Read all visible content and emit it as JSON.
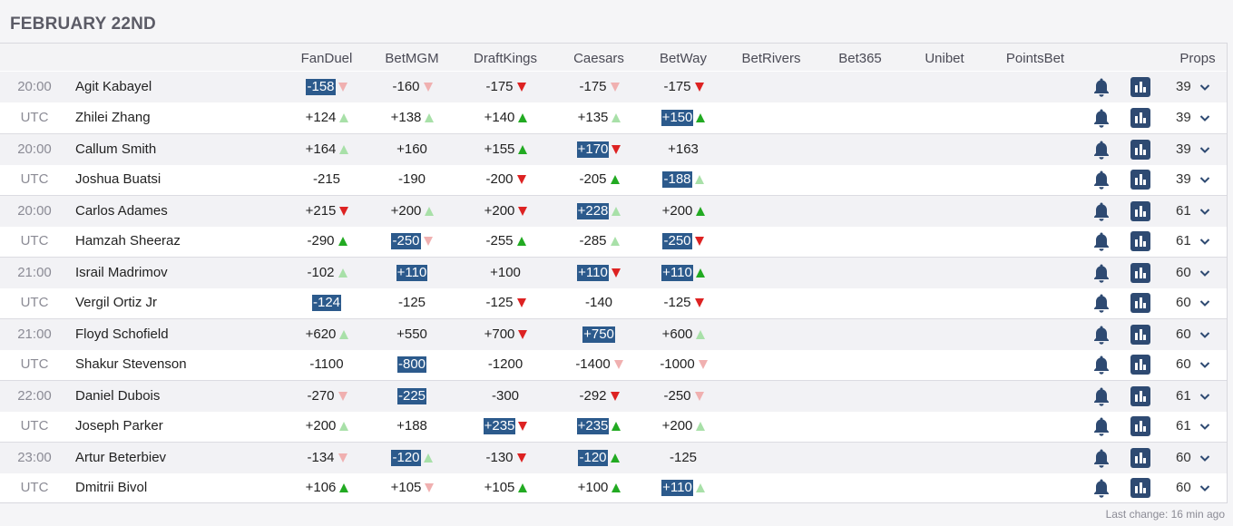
{
  "date_heading": "FEBRUARY 22ND",
  "columns": [
    "FanDuel",
    "BetMGM",
    "DraftKings",
    "Caesars",
    "BetWay",
    "BetRivers",
    "Bet365",
    "Unibet",
    "PointsBet"
  ],
  "props_label": "Props",
  "footer_note": "Last change: 16 min ago",
  "colors": {
    "best_bg": "#2c5a8c",
    "up_strong": "#22aa22",
    "up_light": "#a8e0a8",
    "down_strong": "#dd2222",
    "down_light": "#f0b0b0",
    "icon_navy": "#2e4a72"
  },
  "rows": [
    {
      "time": "20:00",
      "fighter": "Agit Kabayel",
      "props": "39",
      "odds": [
        {
          "v": "-158",
          "best": true,
          "a": "down-light"
        },
        {
          "v": "-160",
          "a": "down-light"
        },
        {
          "v": "-175",
          "a": "down-strong"
        },
        {
          "v": "-175",
          "a": "down-light"
        },
        {
          "v": "-175",
          "a": "down-strong"
        }
      ]
    },
    {
      "time": "UTC",
      "fighter": "Zhilei Zhang",
      "props": "39",
      "odds": [
        {
          "v": "+124",
          "a": "up-light"
        },
        {
          "v": "+138",
          "a": "up-light"
        },
        {
          "v": "+140",
          "a": "up-strong"
        },
        {
          "v": "+135",
          "a": "up-light"
        },
        {
          "v": "+150",
          "best": true,
          "a": "up-strong"
        }
      ]
    },
    {
      "time": "20:00",
      "fighter": "Callum Smith",
      "props": "39",
      "odds": [
        {
          "v": "+164",
          "a": "up-light"
        },
        {
          "v": "+160"
        },
        {
          "v": "+155",
          "a": "up-strong"
        },
        {
          "v": "+170",
          "best": true,
          "a": "down-strong"
        },
        {
          "v": "+163"
        }
      ]
    },
    {
      "time": "UTC",
      "fighter": "Joshua Buatsi",
      "props": "39",
      "odds": [
        {
          "v": "-215"
        },
        {
          "v": "-190"
        },
        {
          "v": "-200",
          "a": "down-strong"
        },
        {
          "v": "-205",
          "a": "up-strong"
        },
        {
          "v": "-188",
          "best": true,
          "a": "up-light"
        }
      ]
    },
    {
      "time": "20:00",
      "fighter": "Carlos Adames",
      "props": "61",
      "odds": [
        {
          "v": "+215",
          "a": "down-strong"
        },
        {
          "v": "+200",
          "a": "up-light"
        },
        {
          "v": "+200",
          "a": "down-strong"
        },
        {
          "v": "+228",
          "best": true,
          "a": "up-light"
        },
        {
          "v": "+200",
          "a": "up-strong"
        }
      ]
    },
    {
      "time": "UTC",
      "fighter": "Hamzah Sheeraz",
      "props": "61",
      "odds": [
        {
          "v": "-290",
          "a": "up-strong"
        },
        {
          "v": "-250",
          "best": true,
          "a": "down-light"
        },
        {
          "v": "-255",
          "a": "up-strong"
        },
        {
          "v": "-285",
          "a": "up-light"
        },
        {
          "v": "-250",
          "best": true,
          "a": "down-strong"
        }
      ]
    },
    {
      "time": "21:00",
      "fighter": "Israil Madrimov",
      "props": "60",
      "odds": [
        {
          "v": "-102",
          "a": "up-light"
        },
        {
          "v": "+110",
          "best": true
        },
        {
          "v": "+100"
        },
        {
          "v": "+110",
          "best": true,
          "a": "down-strong"
        },
        {
          "v": "+110",
          "best": true,
          "a": "up-strong"
        }
      ]
    },
    {
      "time": "UTC",
      "fighter": "Vergil Ortiz Jr",
      "props": "60",
      "odds": [
        {
          "v": "-124",
          "best": true
        },
        {
          "v": "-125"
        },
        {
          "v": "-125",
          "a": "down-strong"
        },
        {
          "v": "-140"
        },
        {
          "v": "-125",
          "a": "down-strong"
        }
      ]
    },
    {
      "time": "21:00",
      "fighter": "Floyd Schofield",
      "props": "60",
      "odds": [
        {
          "v": "+620",
          "a": "up-light"
        },
        {
          "v": "+550"
        },
        {
          "v": "+700",
          "a": "down-strong"
        },
        {
          "v": "+750",
          "best": true
        },
        {
          "v": "+600",
          "a": "up-light"
        }
      ]
    },
    {
      "time": "UTC",
      "fighter": "Shakur Stevenson",
      "props": "60",
      "odds": [
        {
          "v": "-1100"
        },
        {
          "v": "-800",
          "best": true
        },
        {
          "v": "-1200"
        },
        {
          "v": "-1400",
          "a": "down-light"
        },
        {
          "v": "-1000",
          "a": "down-light"
        }
      ]
    },
    {
      "time": "22:00",
      "fighter": "Daniel Dubois",
      "props": "61",
      "odds": [
        {
          "v": "-270",
          "a": "down-light"
        },
        {
          "v": "-225",
          "best": true
        },
        {
          "v": "-300"
        },
        {
          "v": "-292",
          "a": "down-strong"
        },
        {
          "v": "-250",
          "a": "down-light"
        }
      ]
    },
    {
      "time": "UTC",
      "fighter": "Joseph Parker",
      "props": "61",
      "odds": [
        {
          "v": "+200",
          "a": "up-light"
        },
        {
          "v": "+188"
        },
        {
          "v": "+235",
          "best": true,
          "a": "down-strong"
        },
        {
          "v": "+235",
          "best": true,
          "a": "up-strong"
        },
        {
          "v": "+200",
          "a": "up-light"
        }
      ]
    },
    {
      "time": "23:00",
      "fighter": "Artur Beterbiev",
      "props": "60",
      "odds": [
        {
          "v": "-134",
          "a": "down-light"
        },
        {
          "v": "-120",
          "best": true,
          "a": "up-light"
        },
        {
          "v": "-130",
          "a": "down-strong"
        },
        {
          "v": "-120",
          "best": true,
          "a": "up-strong"
        },
        {
          "v": "-125"
        }
      ]
    },
    {
      "time": "UTC",
      "fighter": "Dmitrii Bivol",
      "props": "60",
      "odds": [
        {
          "v": "+106",
          "a": "up-strong"
        },
        {
          "v": "+105",
          "a": "down-light"
        },
        {
          "v": "+105",
          "a": "up-strong"
        },
        {
          "v": "+100",
          "a": "up-strong"
        },
        {
          "v": "+110",
          "best": true,
          "a": "up-light"
        }
      ]
    }
  ]
}
